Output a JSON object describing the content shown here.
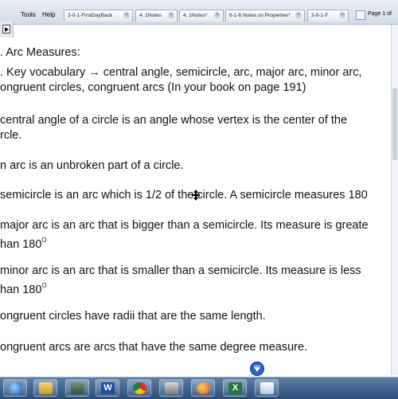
{
  "menu": {
    "tools": "Tools",
    "help": "Help"
  },
  "tabs": [
    {
      "label": "3-0-1-FirstDayBack"
    },
    {
      "label": "4. 1Notes"
    },
    {
      "label": "4. 1Notes*"
    },
    {
      "label": "6-1-6 Notes on Properties*"
    },
    {
      "label": "3-0-1-F"
    }
  ],
  "page_info": "Page 1 of",
  "notes": {
    "heading": ". Arc Measures:",
    "vocab_line1": ". Key vocabulary → central angle, semicircle, arc, major arc, minor arc,",
    "vocab_line2": "ongruent circles, congruent arcs (In your book on page 191)",
    "central1": " central angle of a circle is an angle whose vertex is the center of the",
    "central2": "rcle.",
    "arc": "n arc is an unbroken part of a circle.",
    "semicircle": " semicircle is an arc which is 1/2 of the circle. A semicircle measures 180",
    "major1": " major arc is an arc that is bigger than a semicircle. Its measure is greate",
    "major2": "han 180",
    "minor1": " minor arc is an arc that is smaller than a semicircle. Its measure is less",
    "minor2": "han 180",
    "degree_mark": "O",
    "cong_circles": "ongruent circles have radii that are the same length.",
    "cong_arcs": "ongruent arcs are arcs that have the same degree measure."
  },
  "taskbar": {
    "icons": [
      "ie-icon",
      "explorer-icon",
      "media-icon",
      "word-icon",
      "chrome-icon",
      "smartboard-icon",
      "firefox-icon",
      "excel-icon",
      "notebook-icon"
    ]
  },
  "colors": {
    "taskbar": "#2b4d78",
    "scroll_button": "#2a64c8"
  }
}
